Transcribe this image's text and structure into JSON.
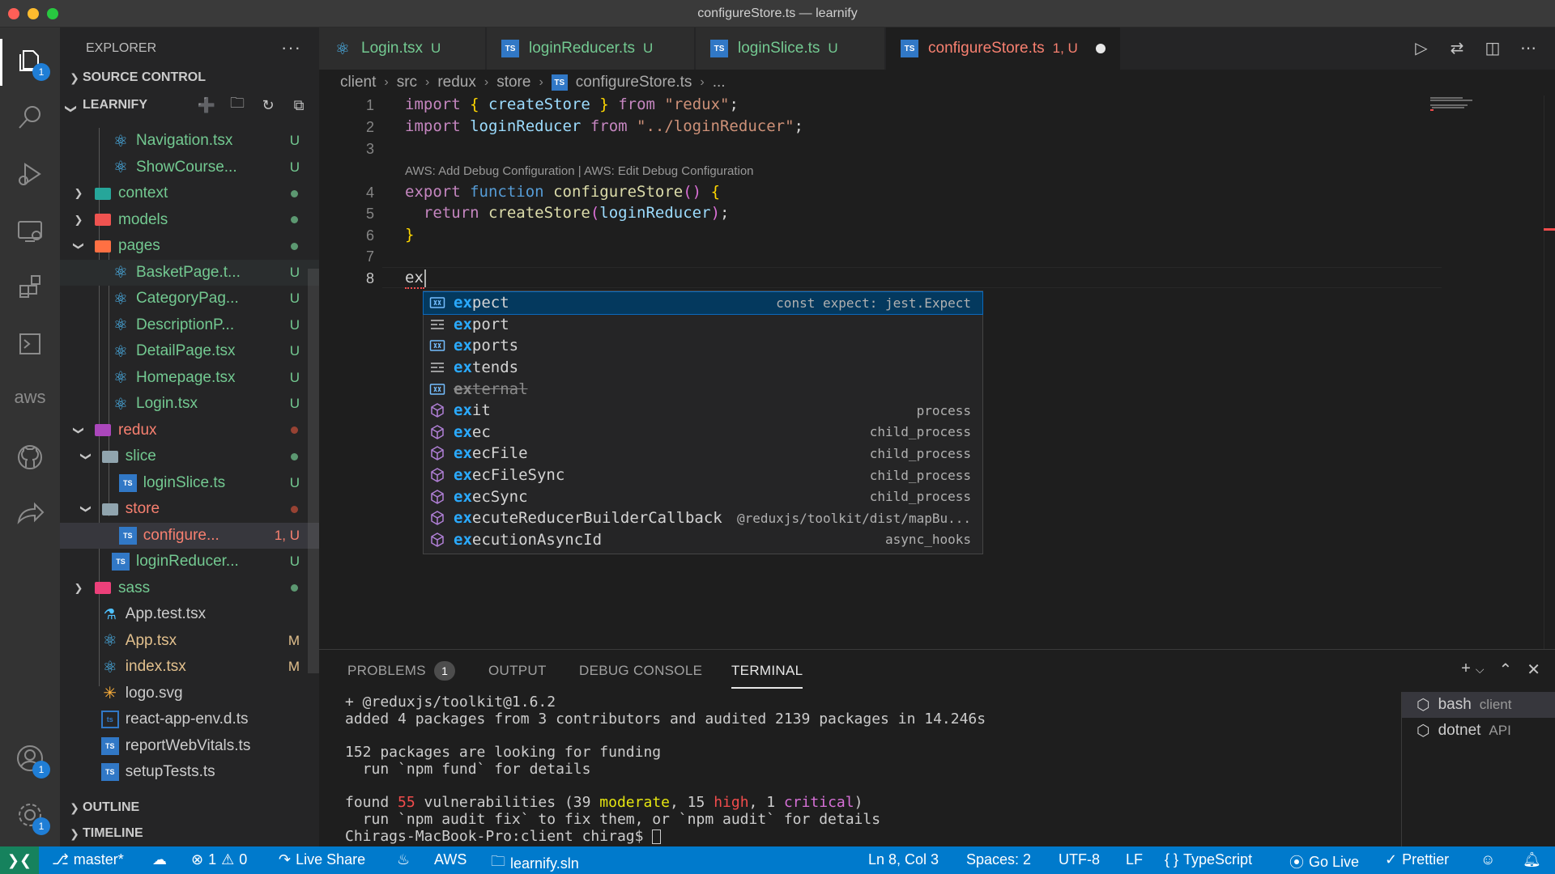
{
  "window": {
    "title": "configureStore.ts — learnify"
  },
  "activity_bar": {
    "explorer_badge": "1",
    "accounts_badge": "1",
    "settings_badge": "1",
    "aws_label": "aws"
  },
  "sidebar": {
    "header": "EXPLORER",
    "source_control": "SOURCE CONTROL",
    "project": "LEARNIFY",
    "outline": "OUTLINE",
    "timeline": "TIMELINE",
    "items": [
      {
        "label": "Navigation.tsx",
        "status": "U"
      },
      {
        "label": "ShowCourse...",
        "status": "U"
      },
      {
        "label": "context",
        "status": ""
      },
      {
        "label": "models",
        "status": ""
      },
      {
        "label": "pages",
        "status": ""
      },
      {
        "label": "BasketPage.t...",
        "status": "U"
      },
      {
        "label": "CategoryPag...",
        "status": "U"
      },
      {
        "label": "DescriptionP...",
        "status": "U"
      },
      {
        "label": "DetailPage.tsx",
        "status": "U"
      },
      {
        "label": "Homepage.tsx",
        "status": "U"
      },
      {
        "label": "Login.tsx",
        "status": "U"
      },
      {
        "label": "redux",
        "status": ""
      },
      {
        "label": "slice",
        "status": ""
      },
      {
        "label": "loginSlice.ts",
        "status": "U"
      },
      {
        "label": "store",
        "status": ""
      },
      {
        "label": "configure...",
        "status": "1, U"
      },
      {
        "label": "loginReducer...",
        "status": "U"
      },
      {
        "label": "sass",
        "status": ""
      },
      {
        "label": "App.test.tsx",
        "status": ""
      },
      {
        "label": "App.tsx",
        "status": "M"
      },
      {
        "label": "index.tsx",
        "status": "M"
      },
      {
        "label": "logo.svg",
        "status": ""
      },
      {
        "label": "react-app-env.d.ts",
        "status": ""
      },
      {
        "label": "reportWebVitals.ts",
        "status": ""
      },
      {
        "label": "setupTests.ts",
        "status": ""
      }
    ]
  },
  "tabs": [
    {
      "label": "Login.tsx",
      "status": "U"
    },
    {
      "label": "loginReducer.ts",
      "status": "U"
    },
    {
      "label": "loginSlice.ts",
      "status": "U"
    },
    {
      "label": "configureStore.ts",
      "status": "1, U"
    }
  ],
  "breadcrumb": [
    "client",
    "src",
    "redux",
    "store",
    "configureStore.ts",
    "..."
  ],
  "editor": {
    "line_numbers": [
      "1",
      "2",
      "3",
      "4",
      "5",
      "6",
      "7",
      "8"
    ],
    "codelens": "AWS: Add Debug Configuration | AWS: Edit Debug Configuration",
    "lines": {
      "l1": {
        "kw_import": "import",
        "open": "{",
        "name": "createStore",
        "close": "}",
        "kw_from": "from",
        "src": "\"redux\"",
        "end": ";"
      },
      "l2": {
        "kw_import": "import",
        "name": "loginReducer",
        "kw_from": "from",
        "src": "\"../loginReducer\"",
        "end": ";"
      },
      "l4": {
        "kw_export": "export",
        "kw_function": "function",
        "name": "configureStore",
        "parens": "()",
        "open": "{"
      },
      "l5": {
        "kw_return": "return",
        "call": "createStore",
        "open": "(",
        "arg": "loginReducer",
        "close": ")",
        "end": ";"
      },
      "l6": {
        "close": "}"
      },
      "l8": {
        "typed": "ex"
      }
    }
  },
  "suggest": {
    "items": [
      {
        "match": "ex",
        "rest": "pect",
        "detail": "const expect: jest.Expect",
        "kind": "variable"
      },
      {
        "match": "ex",
        "rest": "port",
        "detail": "",
        "kind": "keyword"
      },
      {
        "match": "ex",
        "rest": "ports",
        "detail": "",
        "kind": "variable"
      },
      {
        "match": "ex",
        "rest": "tends",
        "detail": "",
        "kind": "keyword"
      },
      {
        "match": "ex",
        "rest": "ternal",
        "detail": "",
        "kind": "variable-deprecated"
      },
      {
        "match": "ex",
        "rest": "it",
        "detail": "process",
        "kind": "module"
      },
      {
        "match": "ex",
        "rest": "ec",
        "detail": "child_process",
        "kind": "module"
      },
      {
        "match": "ex",
        "rest": "ecFile",
        "detail": "child_process",
        "kind": "module"
      },
      {
        "match": "ex",
        "rest": "ecFileSync",
        "detail": "child_process",
        "kind": "module"
      },
      {
        "match": "ex",
        "rest": "ecSync",
        "detail": "child_process",
        "kind": "module"
      },
      {
        "match": "ex",
        "rest": "ecuteReducerBuilderCallback",
        "detail": "@reduxjs/toolkit/dist/mapBu...",
        "kind": "module"
      },
      {
        "match": "ex",
        "rest": "ecutionAsyncId",
        "detail": "async_hooks",
        "kind": "module"
      }
    ]
  },
  "panel": {
    "tabs": {
      "problems": "PROBLEMS",
      "problems_count": "1",
      "output": "OUTPUT",
      "debug": "DEBUG CONSOLE",
      "terminal": "TERMINAL"
    },
    "terminal": {
      "l1": "+ @reduxjs/toolkit@1.6.2",
      "l2": "added 4 packages from 3 contributors and audited 2139 packages in 14.246s",
      "l3": "152 packages are looking for funding",
      "l4": "  run `npm fund` for details",
      "l5_pre": "found ",
      "l5_num": "55",
      "l5_mid1": " vulnerabilities (39 ",
      "l5_mod": "moderate",
      "l5_mid2": ", 15 ",
      "l5_high": "high",
      "l5_mid3": ", 1 ",
      "l5_crit": "critical",
      "l5_end": ")",
      "l6": "  run `npm audit fix` to fix them, or `npm audit` for details",
      "l7": "Chirags-MacBook-Pro:client chirag$ "
    },
    "terminals": [
      {
        "name": "bash",
        "cwd": "client"
      },
      {
        "name": "dotnet",
        "cwd": "API"
      }
    ]
  },
  "statusbar": {
    "branch": "master*",
    "errors": "1",
    "warnings": "0",
    "live_share": "Live Share",
    "aws": "AWS",
    "solution": "learnify.sln",
    "position": "Ln 8, Col 3",
    "spaces": "Spaces: 2",
    "encoding": "UTF-8",
    "eol": "LF",
    "language": "TypeScript",
    "go_live": "Go Live",
    "prettier": "Prettier"
  },
  "colors": {
    "accent": "#007acc",
    "untracked": "#73c991",
    "modified": "#e2c08d",
    "error": "#f88070"
  }
}
